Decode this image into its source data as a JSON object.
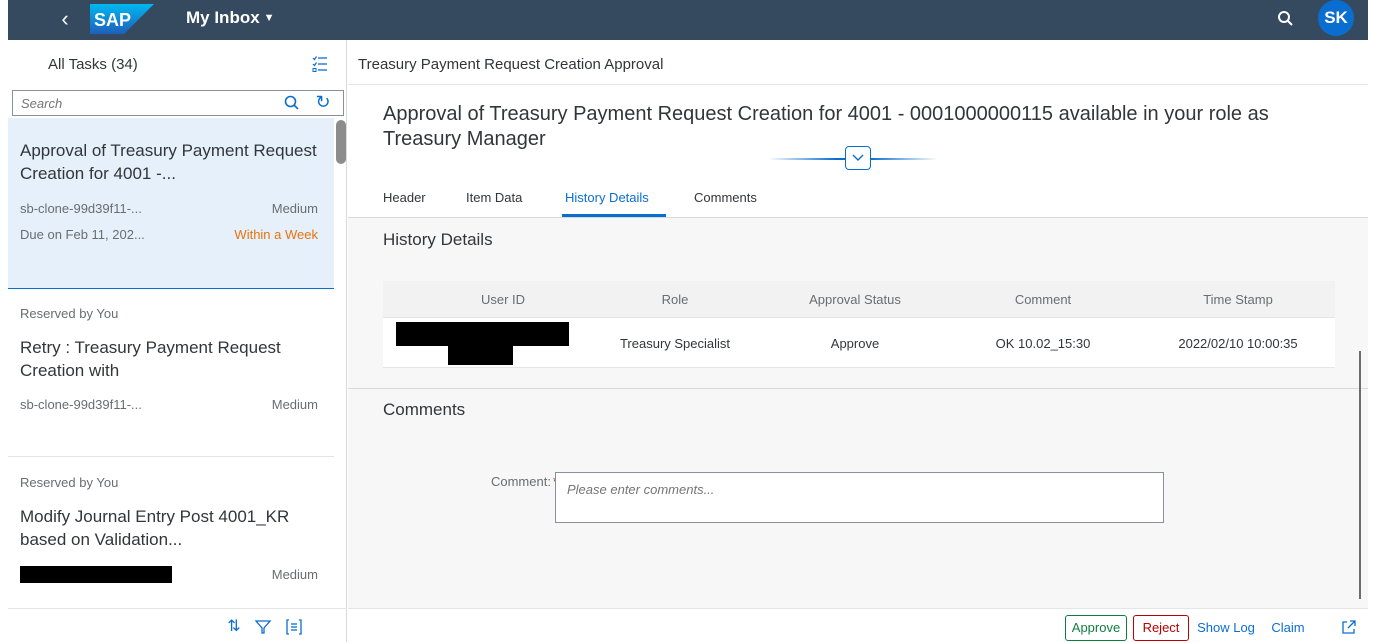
{
  "shell": {
    "app_title": "My Inbox",
    "logo_text": "SAP",
    "avatar_initials": "SK",
    "colors": {
      "shell_bar": "#354a5f",
      "accent": "#0a6ed1",
      "positive": "#107e3e",
      "negative": "#bb0000",
      "critical": "#e9730c"
    }
  },
  "master": {
    "title": "All Tasks (34)",
    "search_placeholder": "Search",
    "tasks": [
      {
        "reserved": "",
        "title": "Approval of Treasury Payment Request Creation for 4001 -...",
        "created_by": "sb-clone-99d39f11-...",
        "priority": "Medium",
        "due": "Due on Feb 11, 202...",
        "status": "Within a Week"
      },
      {
        "reserved": "Reserved by You",
        "title": "Retry : Treasury Payment Request Creation with",
        "created_by": "sb-clone-99d39f11-...",
        "priority": "Medium"
      },
      {
        "reserved": "Reserved by You",
        "title": "Modify Journal Entry Post 4001_KR based on Validation...",
        "created_by": "",
        "priority": "Medium"
      }
    ]
  },
  "detail": {
    "header_title": "Treasury Payment Request Creation Approval",
    "object_title": "Approval of Treasury Payment Request Creation for 4001 - 0001000000115 available in your role as Treasury Manager",
    "tabs": [
      {
        "label": "Header"
      },
      {
        "label": "Item Data"
      },
      {
        "label": "History Details"
      },
      {
        "label": "Comments"
      }
    ],
    "active_tab": "History Details",
    "history": {
      "section_title": "History Details",
      "columns": [
        "User ID",
        "Role",
        "Approval Status",
        "Comment",
        "Time Stamp"
      ],
      "rows": [
        {
          "user_id": "",
          "role": "Treasury Specialist",
          "approval_status": "Approve",
          "comment": "OK 10.02_15:30",
          "time_stamp": "2022/02/10 10:00:35"
        }
      ]
    },
    "comments": {
      "section_title": "Comments",
      "label": "Comment:",
      "required_mark": "*",
      "placeholder": "Please enter comments..."
    }
  },
  "footer": {
    "approve": "Approve",
    "reject": "Reject",
    "show_log": "Show Log",
    "claim": "Claim"
  }
}
